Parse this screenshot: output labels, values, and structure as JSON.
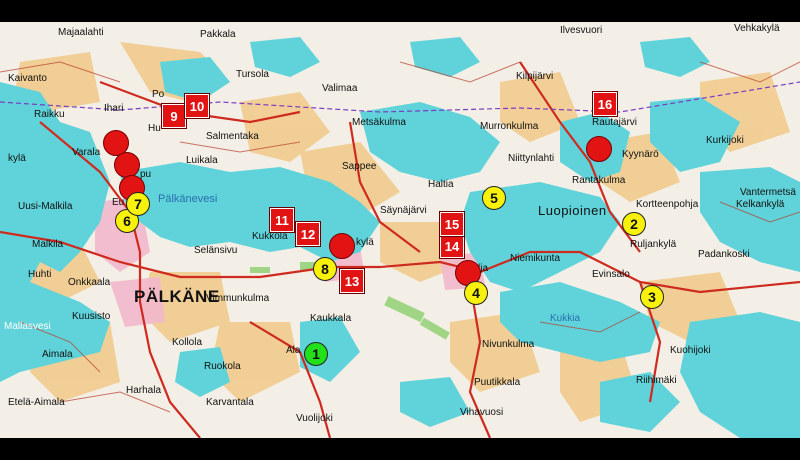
{
  "colors": {
    "water": "#5fd3d9",
    "land": "#f3efe6",
    "field": "#f0c987",
    "urban": "#f2b8cc",
    "road": "#cf2a1f",
    "marker_red": "#e21313",
    "marker_yellow": "#f7f10c",
    "marker_green": "#22e01a"
  },
  "places": {
    "majaalahti": "Majaalahti",
    "kaivanto": "Kaivanto",
    "raikku": "Raikku",
    "varala": "Varala",
    "kyla": "kylä",
    "uusi_malkila": "Uusi-Malkila",
    "malkila": "Malkila",
    "huhti": "Huhti",
    "onkkaala": "Onkkaala",
    "palkane": "PÄLKÄNE",
    "kuusisto": "Kuusisto",
    "mallasvesi": "Mallasvesi",
    "aimala": "Aimala",
    "kollola": "Kollola",
    "ruokola": "Ruokola",
    "harhala": "Harhala",
    "etela_aimala": "Etelä-Aimala",
    "karvantala": "Karvantala",
    "pakkala": "Pakkala",
    "tursola": "Tursola",
    "valimaa": "Valimaa",
    "salmentaka": "Salmentaka",
    "luikala": "Luikala",
    "palkanevesi": "Pälkänevesi",
    "selansivu": "Selänsivu",
    "vimmunkulma": "Vimmunkulma",
    "kaukkala": "Kaukkala",
    "kukkola": "Kukkola",
    "kyla2": "kylä",
    "sappee": "Sappee",
    "metsakulma": "Metsäkulma",
    "murronkulma": "Murronkulma",
    "ilvesvuori": "Ilvesvuori",
    "kilpijarvi": "Kilpijärvi",
    "niittynlahti": "Niittynlahti",
    "haltia": "Haltia",
    "sayna": "Säynäjärvi",
    "luopioinen": "Luopioinen",
    "niemikunta": "Niemikunta",
    "nivunkulma": "Nivunkulma",
    "puutikkala": "Puutikkala",
    "vihavuosi": "Vihavuosi",
    "vuolijoki": "Vuolijoki",
    "rautajarvi": "Rautajärvi",
    "kyynaro": "Kyynärö",
    "rantakulma": "Rantakulma",
    "kortteenpohja": "Kortteenpohja",
    "ruljankyla": "Ruljankylä",
    "padankoski": "Padankoski",
    "evinsalo": "Evinsalo",
    "kuohijoki": "Kuohijoki",
    "riihimaki": "Riihimäki",
    "kurkijoki": "Kurkijoki",
    "vehkakyla": "Vehkakylä",
    "vantermetsa": "Vantermetsä",
    "kelkankyla": "Kelkankylä",
    "kukkia": "Kukkia",
    "ala": "Ala",
    "ilja": "lja",
    "ihari": "Ihari",
    "po": "Po",
    "pu": "pu",
    "huu": "Hu",
    "eu": "Eu"
  },
  "markers": {
    "m1": "1",
    "m2": "2",
    "m3": "3",
    "m4": "4",
    "m5": "5",
    "m6": "6",
    "m7": "7",
    "m8": "8",
    "m9": "9",
    "m10": "10",
    "m11": "11",
    "m12": "12",
    "m13": "13",
    "m14": "14",
    "m15": "15",
    "m16": "16"
  }
}
